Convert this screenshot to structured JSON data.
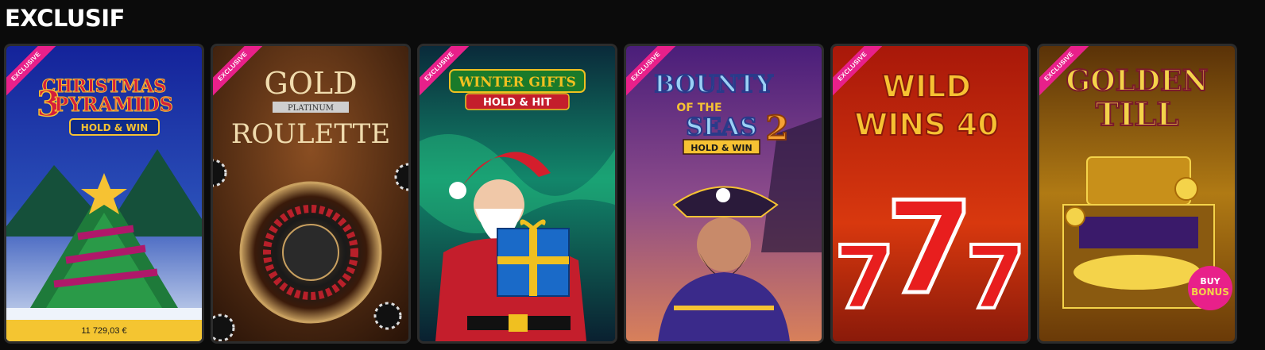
{
  "section": {
    "title": "EXCLUSIF"
  },
  "games": [
    {
      "badge": "EXCLUSIVE",
      "logo_lines": [
        "3",
        "CHRISTMAS",
        "PYRAMIDS",
        "HOLD & WIN"
      ],
      "jackpot": "11 729,03 €",
      "colors": {
        "top": "#1a2fa0",
        "bottom": "#dfe8f5",
        "accent": "#d41e3c"
      }
    },
    {
      "badge": "EXCLUSIVE",
      "logo_lines": [
        "GOLD",
        "PLATINUM",
        "ROULETTE"
      ],
      "colors": {
        "top": "#6b3a17",
        "bottom": "#2a1408",
        "accent": "#e8c98a"
      }
    },
    {
      "badge": "EXCLUSIVE",
      "logo_lines": [
        "WINTER GIFTS",
        "HOLD & HIT"
      ],
      "colors": {
        "top": "#0b2f3d",
        "bottom": "#0a3a2a",
        "accent": "#f0c020"
      }
    },
    {
      "badge": "EXCLUSIVE",
      "logo_lines": [
        "BOUNTY",
        "OF THE",
        "SEAS",
        "2",
        "HOLD & WIN"
      ],
      "colors": {
        "top": "#5a2a8a",
        "bottom": "#c86a4a",
        "accent": "#3a9ad9"
      }
    },
    {
      "badge": "EXCLUSIVE",
      "logo_lines": [
        "WILD",
        "WINS 40"
      ],
      "colors": {
        "top": "#b81e0a",
        "bottom": "#e84a10",
        "accent": "#f6c233"
      }
    },
    {
      "badge": "EXCLUSIVE",
      "logo_lines": [
        "GOLDEN",
        "TILL",
        "BUY",
        "BONUS"
      ],
      "colors": {
        "top": "#5a3208",
        "bottom": "#c88a18",
        "accent": "#f4d34a"
      }
    }
  ]
}
